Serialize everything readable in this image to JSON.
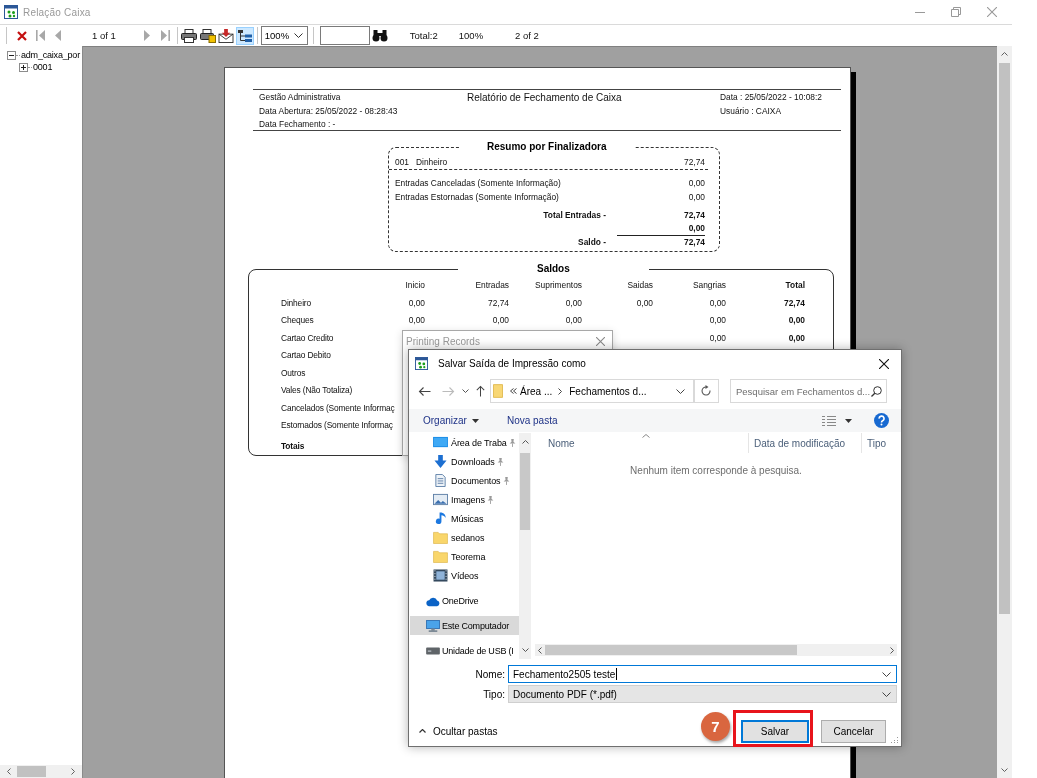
{
  "window": {
    "title": "Relação Caixa",
    "active": false
  },
  "toolbar": {
    "cancel": {
      "disabled": false
    },
    "first": {
      "disabled": true
    },
    "previous": {
      "disabled": true
    },
    "page": "1 of 1",
    "next": {
      "disabled": true
    },
    "last": {
      "disabled": true
    },
    "group_tree": {
      "pressed": true
    },
    "zoom": "100%",
    "total": "Total:2",
    "zoom_reading": "100%",
    "record": "2 of 2"
  },
  "tree": [
    {
      "label": "adm_caixa_por",
      "expanded": true,
      "children": [
        {
          "label": "0001",
          "expanded": false
        }
      ]
    }
  ],
  "report": {
    "company": "Gestão Administrativa",
    "title": "Relatório de Fechamento de Caixa",
    "date": "Data : 25/05/2022 - 10:08:2",
    "opened": "Data Abertura: 25/05/2022 - 08:28:43",
    "user": "Usuário : CAIXA",
    "closed": "Data Fechamento : -",
    "summary": {
      "title": "Resumo por Finalizadora",
      "methods": [
        {
          "code": "001",
          "name": "Dinheiro",
          "value": "72,74"
        }
      ],
      "info": [
        {
          "label": "Entradas Canceladas (Somente Informação)",
          "value": "0,00"
        },
        {
          "label": "Entradas Estornadas (Somente Informação)",
          "value": "0,00"
        }
      ],
      "totals": [
        {
          "label": "Total Entradas -",
          "value": "72,74"
        },
        {
          "value": "0,00"
        }
      ],
      "balance": {
        "label": "Saldo -",
        "value": "72,74"
      }
    },
    "balances": {
      "title": "Saldos",
      "columns": [
        "Inicio",
        "Entradas",
        "Suprimentos",
        "Saidas",
        "Sangrias",
        "Total"
      ],
      "rows": [
        {
          "label": "Dinheiro",
          "kind": "line",
          "cells": [
            "0,00",
            "72,74",
            "0,00",
            "0,00",
            "0,00",
            "72,74"
          ]
        },
        {
          "label": "Cheques",
          "kind": "line",
          "cells": [
            "0,00",
            "0,00",
            "0,00",
            null,
            "0,00",
            "0,00"
          ]
        },
        {
          "label": "Cartao Credito",
          "kind": "line",
          "cells": [
            null,
            null,
            null,
            null,
            "0,00",
            "0,00"
          ]
        },
        {
          "label": "Cartao Debito",
          "kind": "line"
        },
        {
          "label": "Outros",
          "kind": "line"
        },
        {
          "label": "Vales (Não Totaliza)",
          "kind": "line"
        },
        {
          "label": "Cancelados (Somente Informaç",
          "kind": "line"
        },
        {
          "label": "Estornados (Somente Informaç",
          "kind": "line"
        },
        {
          "label": "Totais",
          "kind": "total"
        }
      ]
    }
  },
  "printing_window": {
    "title": "Printing Records"
  },
  "save_dialog": {
    "title": "Salvar Saída de Impressão como",
    "back": {
      "disabled": false
    },
    "forward": {
      "disabled": true
    },
    "breadcrumb": [
      "Área ...",
      "Fechamentos d..."
    ],
    "search": {
      "placeholder": "Pesquisar em Fechamentos d..."
    },
    "commands": [
      {
        "label": "Organizar",
        "menu": true
      },
      {
        "label": "Nova pasta",
        "menu": false
      }
    ],
    "nav_pane": {
      "shortcuts": [
        {
          "label": "Área de Traba",
          "kind": "desktop",
          "pinned": true,
          "selected": false
        },
        {
          "label": "Downloads",
          "kind": "downloads",
          "pinned": true,
          "selected": false
        },
        {
          "label": "Documentos",
          "kind": "documents",
          "pinned": true,
          "selected": false
        },
        {
          "label": "Imagens",
          "kind": "pictures",
          "pinned": true,
          "selected": false
        },
        {
          "label": "Músicas",
          "kind": "music",
          "pinned": false,
          "selected": false
        },
        {
          "label": "sedanos",
          "kind": "folder",
          "pinned": false,
          "selected": false
        },
        {
          "label": "Teorema",
          "kind": "folder",
          "pinned": false,
          "selected": false
        },
        {
          "label": "Vídeos",
          "kind": "videos",
          "pinned": false,
          "selected": false
        }
      ],
      "places": [
        {
          "label": "OneDrive",
          "kind": "cloud",
          "selected": false
        },
        {
          "label": "Este Computador",
          "kind": "computer",
          "selected": true
        },
        {
          "label": "Unidade de USB (I",
          "kind": "usb_drive",
          "selected": false
        }
      ]
    },
    "columns": [
      {
        "label": "Nome",
        "sorted": true
      },
      {
        "label": "Data de modificação",
        "sorted": false
      },
      {
        "label": "Tipo",
        "sorted": false
      }
    ],
    "empty_message": "Nenhum item corresponde à pesquisa.",
    "file_name": {
      "label": "Nome:",
      "value": "Fechamento2505 teste"
    },
    "file_type": {
      "label": "Tipo:",
      "value": "Documento PDF (*.pdf)"
    },
    "toggle_folders": "Ocultar pastas",
    "buttons": [
      {
        "label": "Salvar",
        "default": true
      },
      {
        "label": "Cancelar",
        "default": false
      }
    ]
  },
  "annotation": {
    "step": "7"
  }
}
